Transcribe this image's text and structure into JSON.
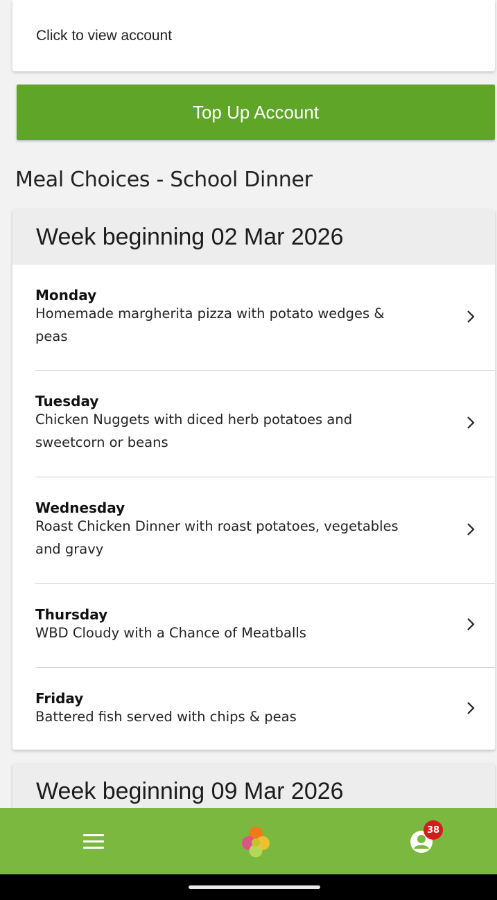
{
  "account": {
    "link_text": "Click to view account"
  },
  "topup": {
    "label": "Top Up Account"
  },
  "section": {
    "title": "Meal Choices - School Dinner"
  },
  "weeks": [
    {
      "header": "Week beginning 02 Mar 2026",
      "days": [
        {
          "day": "Monday",
          "meal_line1": "Homemade margherita pizza with potato wedges &",
          "meal_line2": "peas"
        },
        {
          "day": "Tuesday",
          "meal_line1": "Chicken Nuggets with diced herb potatoes and",
          "meal_line2": "sweetcorn or beans"
        },
        {
          "day": "Wednesday",
          "meal_line1": "Roast Chicken Dinner with roast potatoes, vegetables",
          "meal_line2": "and gravy"
        },
        {
          "day": "Thursday",
          "meal_line1": "WBD Cloudy with a Chance of Meatballs",
          "meal_line2": ""
        },
        {
          "day": "Friday",
          "meal_line1": "Battered fish served with chips & peas",
          "meal_line2": ""
        }
      ]
    },
    {
      "header": "Week beginning 09 Mar 2026",
      "days": []
    }
  ],
  "nav": {
    "menu_icon": "hamburger-menu-icon",
    "home_icon": "app-logo-icon",
    "profile_icon": "user-profile-icon",
    "notification_count": "38"
  },
  "colors": {
    "accent_green": "#5fa527",
    "nav_green": "#7ab83f",
    "badge_red": "#d21d1d"
  }
}
